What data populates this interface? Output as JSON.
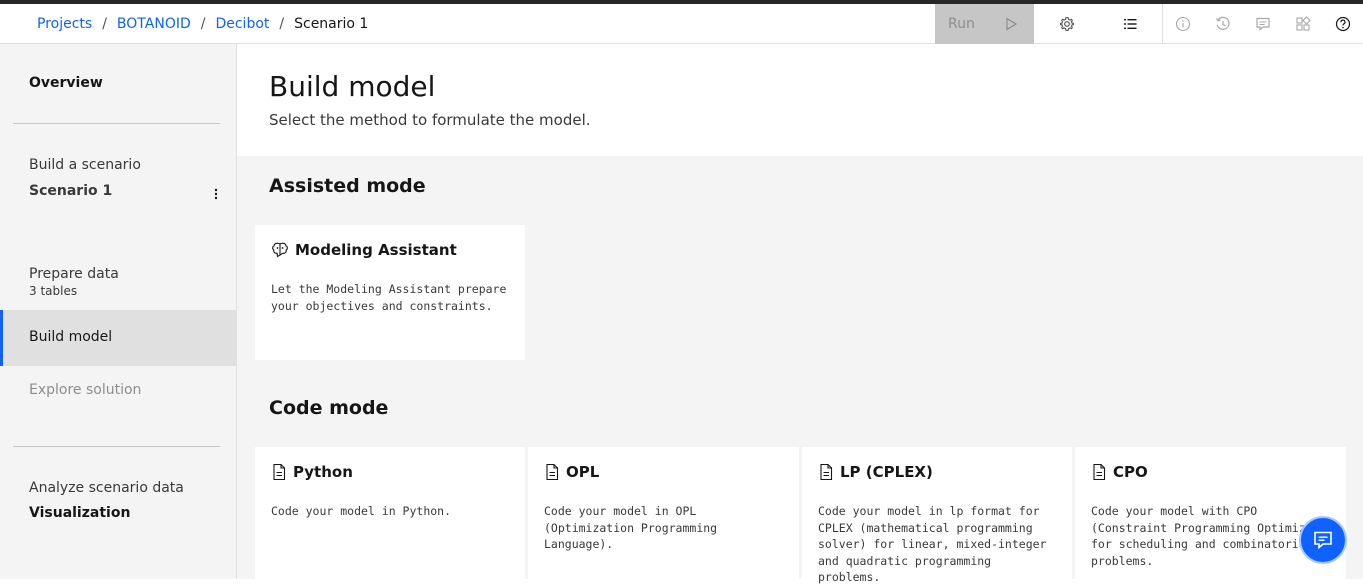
{
  "breadcrumb": {
    "items": [
      "Projects",
      "BOTANOID",
      "Decibot"
    ],
    "separator": "/",
    "current": "Scenario 1"
  },
  "toolbar": {
    "run_label": "Run",
    "icons": [
      "play-icon",
      "settings-icon",
      "list-icon",
      "info-icon",
      "history-icon",
      "comment-icon",
      "apps-icon",
      "help-icon"
    ]
  },
  "sidebar": {
    "overview": "Overview",
    "build_scenario_label": "Build a scenario",
    "scenario_name": "Scenario 1",
    "prepare_data": "Prepare data",
    "prepare_data_sub": "3 tables",
    "build_model": "Build model",
    "explore_solution": "Explore solution",
    "analyze_label": "Analyze scenario data",
    "visualization": "Visualization"
  },
  "main": {
    "title": "Build model",
    "subtitle": "Select the method to formulate the model.",
    "assisted_title": "Assisted mode",
    "assistant_tile": {
      "title": "Modeling Assistant",
      "description": "Let the Modeling Assistant prepare your objectives and constraints."
    },
    "code_title": "Code mode",
    "code_tiles": [
      {
        "title": "Python",
        "description": "Code your model in Python."
      },
      {
        "title": "OPL",
        "description": "Code your model in OPL (Optimization Programming Language)."
      },
      {
        "title": "LP (CPLEX)",
        "description": "Code your model in lp format for CPLEX (mathematical programming solver) for linear, mixed-integer and quadratic programming problems."
      },
      {
        "title": "CPO",
        "description": "Code your model with CPO (Constraint Programming Optimizer) for scheduling and combinatorial problems."
      }
    ]
  },
  "colors": {
    "accent": "#0f62fe",
    "background": "#f4f4f4",
    "run_disabled": "#c6c6c6"
  }
}
